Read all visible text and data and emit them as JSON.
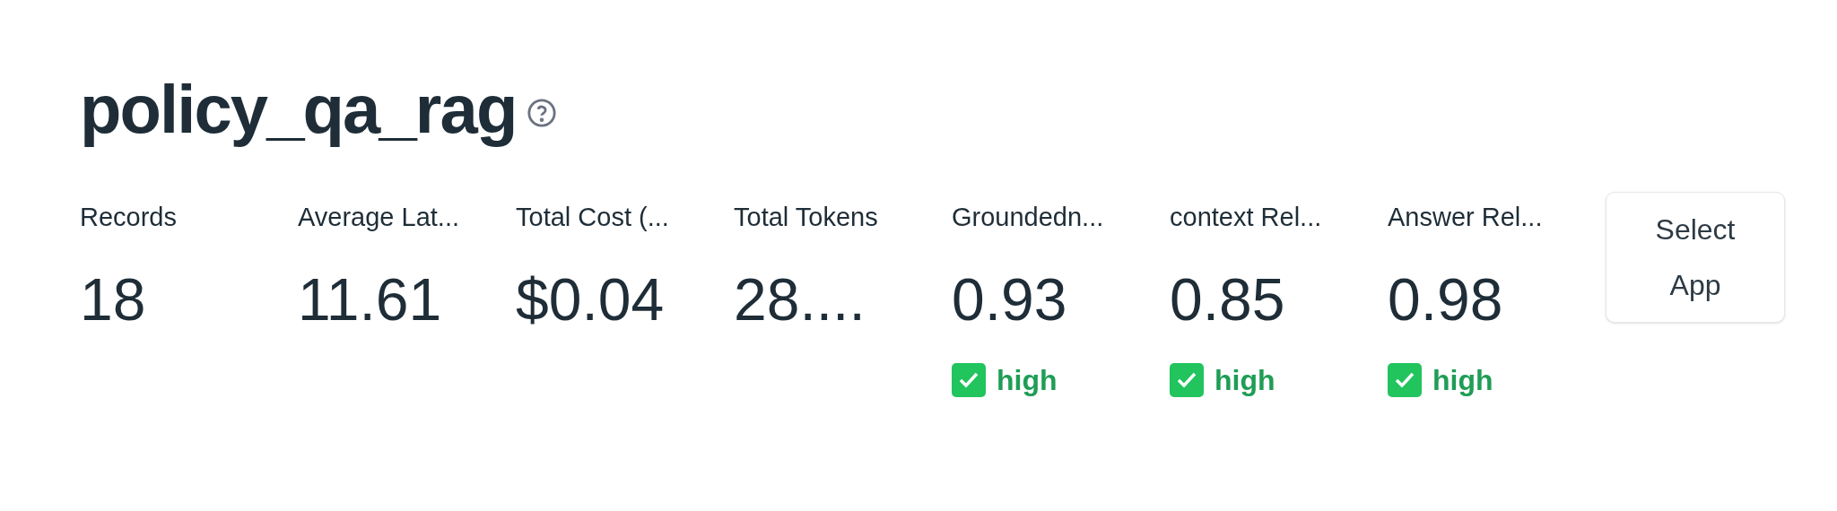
{
  "title": "policy_qa_rag",
  "metrics": [
    {
      "label": "Records",
      "value": "18"
    },
    {
      "label": "Average Lat...",
      "value": "11.61"
    },
    {
      "label": "Total Cost (...",
      "value": "$0.04"
    },
    {
      "label": "Total Tokens",
      "value": "28...."
    },
    {
      "label": "Groundedn...",
      "value": "0.93",
      "badge": {
        "label": "high",
        "checked": true
      }
    },
    {
      "label": "context Rel...",
      "value": "0.85",
      "badge": {
        "label": "high",
        "checked": true
      }
    },
    {
      "label": "Answer Rel...",
      "value": "0.98",
      "badge": {
        "label": "high",
        "checked": true
      }
    }
  ],
  "button": "Select App"
}
